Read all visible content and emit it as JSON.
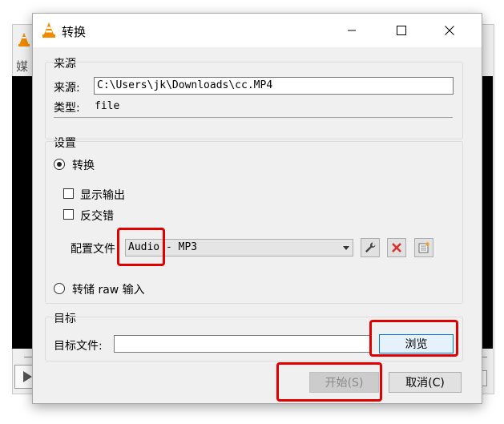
{
  "background_window": {
    "side_label": "媒"
  },
  "dialog": {
    "title": "转换",
    "source_group": {
      "heading": "来源",
      "source_label": "来源:",
      "source_value": "C:\\Users\\jk\\Downloads\\cc.MP4",
      "type_label": "类型:",
      "type_value": "file"
    },
    "settings_group": {
      "heading": "设置",
      "convert_label": "转换",
      "show_output_label": "显示输出",
      "deinterlace_label": "反交错",
      "profile_label": "配置文件",
      "profile_value": "Audio - MP3",
      "dump_raw_label": "转储 raw 输入"
    },
    "target_group": {
      "heading": "目标",
      "dest_label": "目标文件:",
      "dest_value": "",
      "browse_label": "浏览"
    },
    "start_label": "开始(S)",
    "cancel_label": "取消(C)"
  },
  "colors": {
    "highlight": "#e00000",
    "delete_icon": "#d9302b",
    "default_button_border": "#0078d7"
  }
}
